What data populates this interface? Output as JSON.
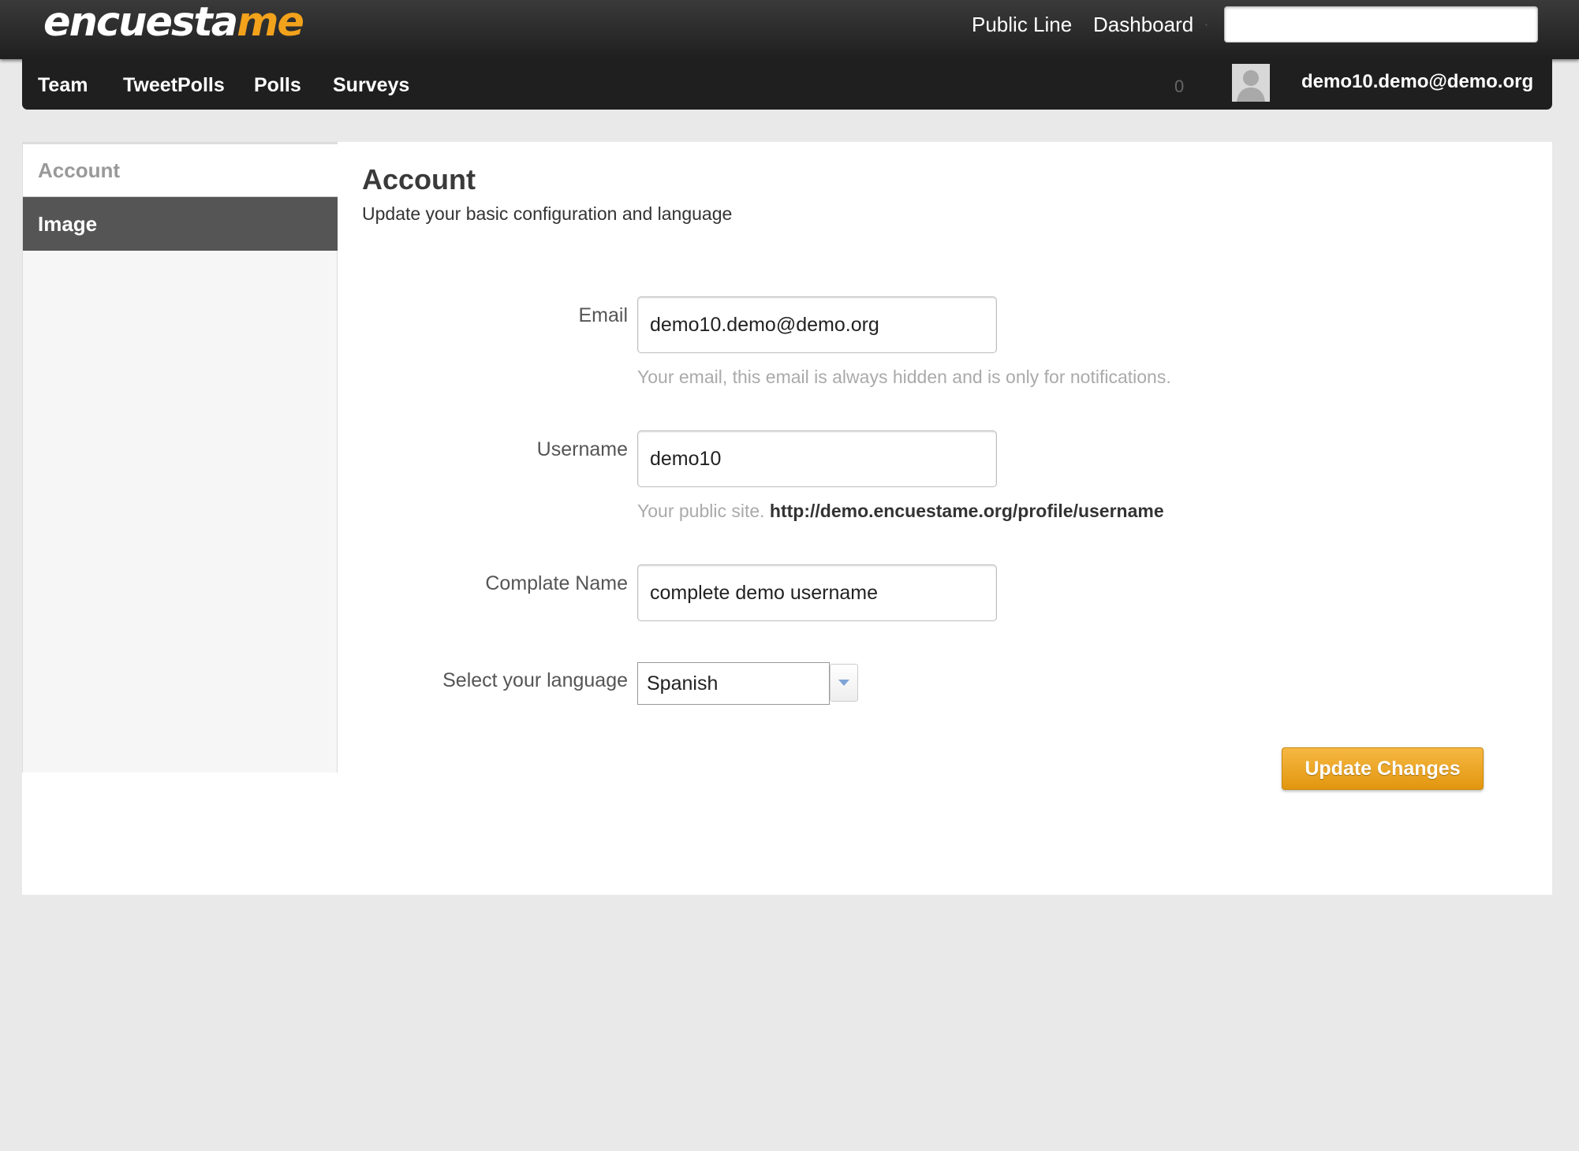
{
  "brand": {
    "logo_part1": "encuesta",
    "logo_part2": "me",
    "accent": "#f3a21c"
  },
  "topbar": {
    "public_line": "Public Line",
    "dashboard": "Dashboard",
    "search_placeholder": ""
  },
  "nav": {
    "items": [
      {
        "label": "Team"
      },
      {
        "label": "TweetPolls"
      },
      {
        "label": "Polls"
      },
      {
        "label": "Surveys"
      }
    ],
    "notification_count": "0",
    "user_email": "demo10.demo@demo.org"
  },
  "sidebar": {
    "items": [
      {
        "label": "Account"
      },
      {
        "label": "Image"
      }
    ]
  },
  "main": {
    "title": "Account",
    "subtitle": "Update your basic configuration and language",
    "email": {
      "label": "Email",
      "value": "demo10.demo@demo.org",
      "help": "Your email, this email is always hidden and is only for notifications."
    },
    "username": {
      "label": "Username",
      "value": "demo10",
      "help": "Your public site.",
      "help_url": "http://demo.encuestame.org/profile/username"
    },
    "complete_name": {
      "label": "Complate Name",
      "value": "complete demo username"
    },
    "language": {
      "label": "Select your language",
      "value": "Spanish"
    },
    "update_button": "Update Changes"
  }
}
